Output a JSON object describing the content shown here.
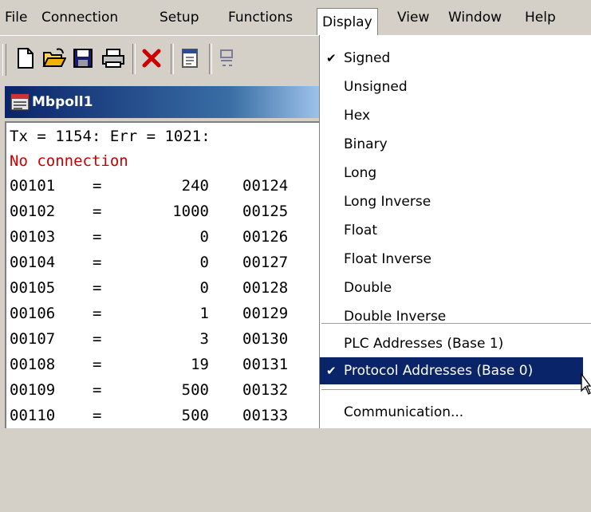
{
  "menubar": {
    "items": [
      "File",
      "Connection",
      "Setup",
      "Functions",
      "Display",
      "View",
      "Window",
      "Help"
    ],
    "active": "Display"
  },
  "toolbar": {
    "buttons": [
      "new-document-icon",
      "open-folder-icon",
      "save-disk-icon",
      "printer-icon",
      "delete-x-icon",
      "window-icon",
      "read-registers-icon"
    ]
  },
  "child_window": {
    "title": "Mbpoll1",
    "status_line": "Tx = 1154: Err = 1021:",
    "connection_status": "No connection",
    "rows": [
      {
        "addr": "00101",
        "eq": "=",
        "value": "240",
        "addr2": "00124"
      },
      {
        "addr": "00102",
        "eq": "=",
        "value": "1000",
        "addr2": "00125"
      },
      {
        "addr": "00103",
        "eq": "=",
        "value": "0",
        "addr2": "00126"
      },
      {
        "addr": "00104",
        "eq": "=",
        "value": "0",
        "addr2": "00127"
      },
      {
        "addr": "00105",
        "eq": "=",
        "value": "0",
        "addr2": "00128"
      },
      {
        "addr": "00106",
        "eq": "=",
        "value": "1",
        "addr2": "00129"
      },
      {
        "addr": "00107",
        "eq": "=",
        "value": "3",
        "addr2": "00130"
      },
      {
        "addr": "00108",
        "eq": "=",
        "value": "19",
        "addr2": "00131"
      },
      {
        "addr": "00109",
        "eq": "=",
        "value": "500",
        "addr2": "00132"
      },
      {
        "addr": "00110",
        "eq": "=",
        "value": "500",
        "addr2": "00133"
      }
    ]
  },
  "display_menu": {
    "check_mark": "✔",
    "items": [
      {
        "label": "Signed",
        "checked": true
      },
      {
        "label": "Unsigned",
        "checked": false
      },
      {
        "label": "Hex",
        "checked": false
      },
      {
        "label": "Binary",
        "checked": false
      },
      {
        "label": "Long",
        "checked": false
      },
      {
        "label": "Long Inverse",
        "checked": false
      },
      {
        "label": "Float",
        "checked": false
      },
      {
        "label": "Float Inverse",
        "checked": false
      },
      {
        "label": "Double",
        "checked": false
      },
      {
        "label": "Double Inverse",
        "checked": false
      },
      {
        "label": "PLC Addresses (Base 1)",
        "checked": false
      },
      {
        "label": "Protocol Addresses (Base 0)",
        "checked": true,
        "highlighted": true
      },
      {
        "label": "Communication...",
        "checked": false
      }
    ]
  },
  "colors": {
    "title_bar": "#0a246a",
    "error_text": "#cc0000",
    "menu_highlight": "#0a246a"
  }
}
